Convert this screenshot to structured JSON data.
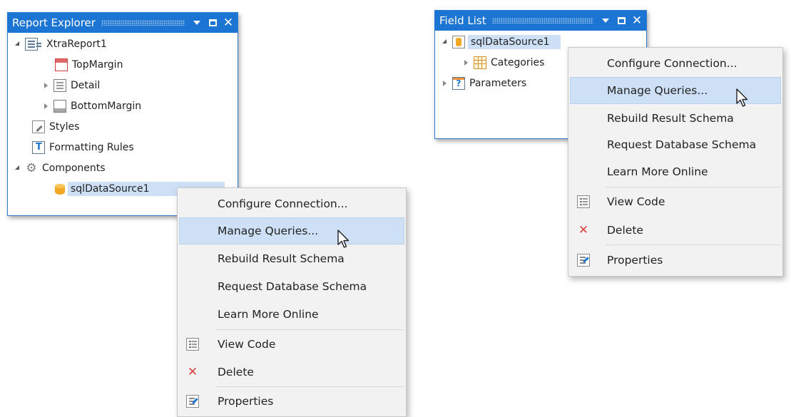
{
  "report_explorer": {
    "title": "Report Explorer",
    "items": [
      {
        "label": "XtraReport1",
        "icon": "report-icon"
      },
      {
        "label": "TopMargin",
        "icon": "top-margin-band-icon"
      },
      {
        "label": "Detail",
        "icon": "detail-band-icon"
      },
      {
        "label": "BottomMargin",
        "icon": "bottom-margin-band-icon"
      },
      {
        "label": "Styles",
        "icon": "styles-icon"
      },
      {
        "label": "Formatting Rules",
        "icon": "formatting-rules-icon"
      },
      {
        "label": "Components",
        "icon": "gear-icon"
      },
      {
        "label": "sqlDataSource1",
        "icon": "database-icon"
      }
    ]
  },
  "field_list": {
    "title": "Field List",
    "items": [
      {
        "label": "sqlDataSource1",
        "icon": "database-icon"
      },
      {
        "label": "Categories",
        "icon": "table-icon"
      },
      {
        "label": "Parameters",
        "icon": "parameters-icon"
      }
    ]
  },
  "context_menu": {
    "items": [
      {
        "label": "Configure Connection..."
      },
      {
        "label": "Manage Queries..."
      },
      {
        "label": "Rebuild Result Schema"
      },
      {
        "label": "Request Database Schema"
      },
      {
        "label": "Learn More Online"
      },
      {
        "label": "View Code",
        "icon": "view-code-icon"
      },
      {
        "label": "Delete",
        "icon": "delete-icon"
      },
      {
        "label": "Properties",
        "icon": "properties-icon"
      }
    ]
  },
  "colors": {
    "title_bar": "#1c75d2",
    "selection": "#cde0f5",
    "menu_background": "#f2f2f2",
    "delete": "#d94040"
  }
}
